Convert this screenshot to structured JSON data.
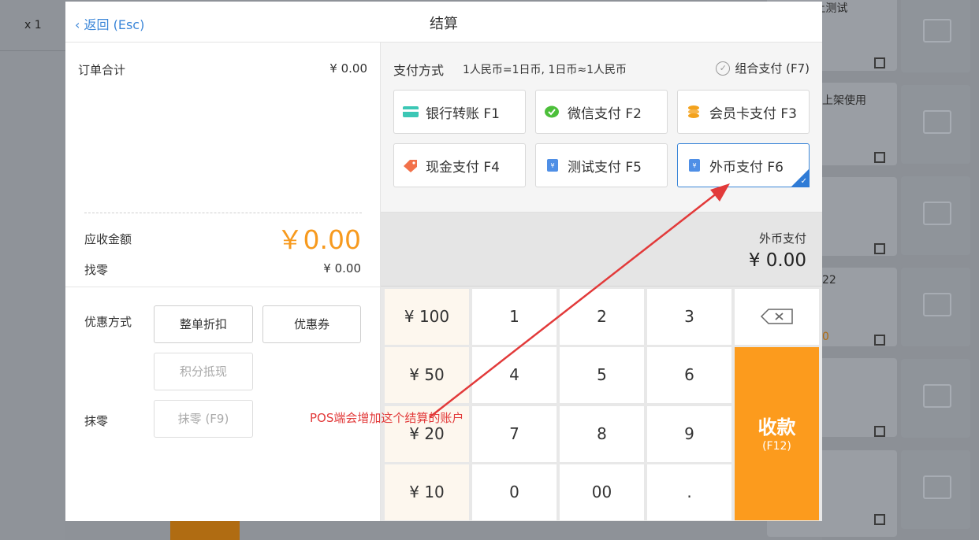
{
  "background": {
    "left_qty": "x 1",
    "texts": [
      "POS上测试",
      "上架使用",
      "22",
      "0"
    ]
  },
  "dialog": {
    "back_label": "返回 (Esc)",
    "title": "结算"
  },
  "left": {
    "order_total_label": "订单合计",
    "order_total_value": "¥ 0.00",
    "amount_due_label": "应收金额",
    "amount_due_value": "￥0.00",
    "change_label": "找零",
    "change_value": "¥ 0.00",
    "discount_label": "优惠方式",
    "round_label": "抹零",
    "buttons": {
      "whole_discount": "整单折扣",
      "coupon": "优惠券",
      "points": "积分抵现",
      "round_off": "抹零 (F9)"
    }
  },
  "payment": {
    "title": "支付方式",
    "rate_note": "1人民币=1日币, 1日币≈1人民币",
    "combo_label": "组合支付 (F7)",
    "methods": [
      {
        "label": "银行转账 F1",
        "icon": "bank-card-icon"
      },
      {
        "label": "微信支付 F2",
        "icon": "wechat-icon"
      },
      {
        "label": "会员卡支付 F3",
        "icon": "coins-icon"
      },
      {
        "label": "现金支付 F4",
        "icon": "cash-tag-icon"
      },
      {
        "label": "测试支付 F5",
        "icon": "voucher-icon"
      },
      {
        "label": "外币支付 F6",
        "icon": "voucher-icon"
      }
    ],
    "selected_method": "外币支付 F6",
    "amount_label": "外币支付",
    "amount_value": "¥ 0.00"
  },
  "keypad": {
    "quick": [
      "¥ 100",
      "¥ 50",
      "¥ 20",
      "¥ 10"
    ],
    "digits": [
      "1",
      "2",
      "3",
      "4",
      "5",
      "6",
      "7",
      "8",
      "9",
      "0",
      "00",
      "."
    ],
    "checkout_label": "收款",
    "checkout_key": "(F12)"
  },
  "annotation": {
    "text": "POS端会增加这个结算的账户"
  },
  "colors": {
    "accent_orange": "#fc9b1d",
    "link_blue": "#3b86d8",
    "annotation_red": "#e23a3a"
  }
}
